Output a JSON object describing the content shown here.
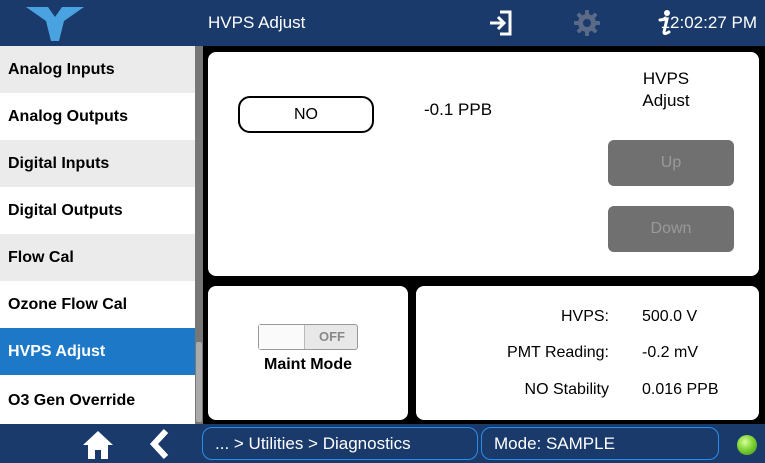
{
  "header": {
    "title": "HVPS Adjust",
    "time": "12:02:27 PM",
    "icons": [
      "logo-icon",
      "login-icon",
      "gear-icon",
      "info-icon"
    ]
  },
  "sidebar": {
    "items": [
      {
        "label": "Analog Inputs"
      },
      {
        "label": "Analog Outputs"
      },
      {
        "label": "Digital Inputs"
      },
      {
        "label": "Digital Outputs"
      },
      {
        "label": "Flow Cal"
      },
      {
        "label": "Ozone Flow Cal"
      },
      {
        "label": "HVPS Adjust",
        "selected": true
      },
      {
        "label": "O3 Gen Override"
      }
    ]
  },
  "main": {
    "gas_button": "NO",
    "concentration": "-0.1 PPB",
    "heading": "HVPS Adjust",
    "up_label": "Up",
    "down_label": "Down"
  },
  "maint": {
    "toggle_state": "OFF",
    "caption": "Maint Mode"
  },
  "readings": [
    {
      "label": "HVPS:",
      "value": "500.0 V"
    },
    {
      "label": "PMT Reading:",
      "value": "-0.2 mV"
    },
    {
      "label": "NO Stability",
      "value": "0.016 PPB"
    }
  ],
  "footer": {
    "breadcrumb": "... > Utilities > Diagnostics",
    "mode": "Mode: SAMPLE",
    "icons": [
      "home-icon",
      "back-icon",
      "status-led-icon"
    ]
  },
  "colors": {
    "header_bg": "#1a3a6b",
    "selected_bg": "#1e78c8",
    "disabled_button": "#707070",
    "led": "#7fd437"
  }
}
